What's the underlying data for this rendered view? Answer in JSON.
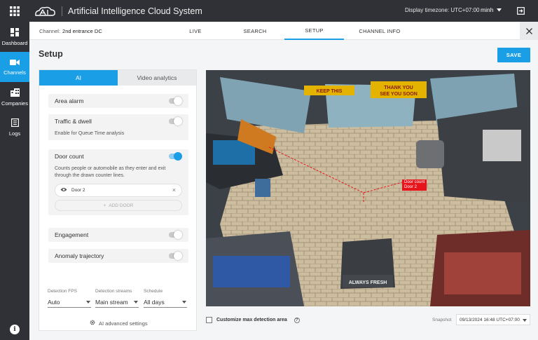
{
  "app": {
    "title": "Artificial Intelligence Cloud System",
    "timezone_label": "Display timezone: UTC+07:00",
    "user": "minh"
  },
  "sidebar": {
    "items": [
      {
        "label": "Dashboard",
        "icon": "dashboard-icon"
      },
      {
        "label": "Channels",
        "icon": "video-camera-icon"
      },
      {
        "label": "Companies",
        "icon": "building-icon"
      },
      {
        "label": "Logs",
        "icon": "log-list-icon"
      }
    ]
  },
  "channel": {
    "prefix": "Channel:",
    "name": "2nd entrance DC"
  },
  "tabs": [
    "LIVE",
    "SEARCH",
    "SETUP",
    "CHANNEL INFO"
  ],
  "page": {
    "title": "Setup",
    "save_label": "SAVE"
  },
  "panel": {
    "tabs": [
      "AI",
      "Video analytics"
    ],
    "features": {
      "area_alarm": {
        "label": "Area alarm",
        "enabled": false
      },
      "traffic": {
        "label": "Traffic & dwell",
        "desc": "Enable for Queue Time analysis",
        "enabled": false
      },
      "door_count": {
        "label": "Door count",
        "desc": "Counts people or automobile as they enter and exit through the drawn counter lines.",
        "enabled": true,
        "door_name": "Door 2",
        "add_label": "ADD DOOR"
      },
      "engagement": {
        "label": "Engagement",
        "enabled": false
      },
      "anomaly": {
        "label": "Anomaly trajectory",
        "enabled": false
      }
    },
    "settings": {
      "fps": {
        "label": "Detection FPS",
        "value": "Auto"
      },
      "streams": {
        "label": "Detection streams",
        "value": "Main stream"
      },
      "schedule": {
        "label": "Schedule",
        "value": "All days"
      }
    },
    "advanced_label": "AI advanced settings"
  },
  "camera": {
    "overlay_line1": "Door count",
    "overlay_line2": "Door 2",
    "sign_left": "KEEP THIS",
    "sign_right_1": "THANK YOU",
    "sign_right_2": "SEE YOU SOON",
    "box_text": "ALWAYS FRESH"
  },
  "bottom": {
    "customize_label": "Customize max detection area",
    "snapshot_label": "Snapshot",
    "snapshot_value": "09/13/2024 16:48 UTC+07:00"
  },
  "colors": {
    "accent": "#1a9fe6",
    "dark": "#2f3136",
    "alert": "#e8141c"
  }
}
